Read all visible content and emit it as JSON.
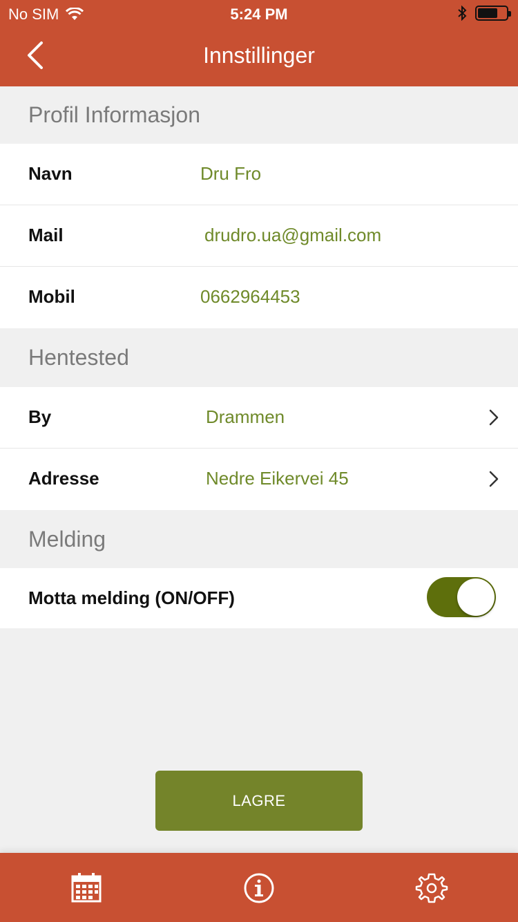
{
  "status_bar": {
    "carrier": "No SIM",
    "time": "5:24 PM"
  },
  "nav": {
    "title": "Innstillinger"
  },
  "sections": {
    "profile": {
      "title": "Profil Informasjon",
      "rows": [
        {
          "label": "Navn",
          "value": "Dru Fro"
        },
        {
          "label": "Mail",
          "value": "drudro.ua@gmail.com"
        },
        {
          "label": "Mobil",
          "value": "0662964453"
        }
      ]
    },
    "pickup": {
      "title": "Hentested",
      "rows": [
        {
          "label": "By",
          "value": "Drammen"
        },
        {
          "label": "Adresse",
          "value": "Nedre Eikervei 45"
        }
      ]
    },
    "message": {
      "title": "Melding",
      "toggle_label": "Motta melding (ON/OFF)",
      "toggle_on": true
    }
  },
  "save_button": {
    "label": "LAGRE"
  },
  "tabbar": {
    "icons": [
      "calendar-icon",
      "info-icon",
      "gear-icon"
    ]
  },
  "colors": {
    "header": "#c85032",
    "value_text": "#6f8a2a",
    "save_button": "#74842a",
    "toggle_on": "#5e6f0c"
  }
}
